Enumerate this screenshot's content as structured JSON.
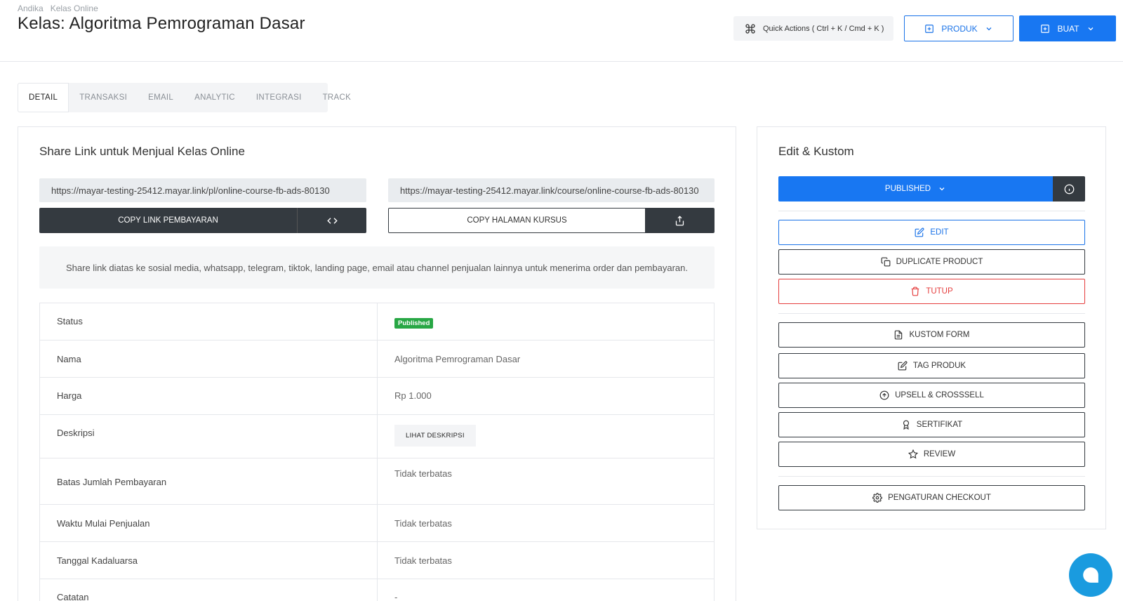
{
  "header": {
    "breadcrumb": [
      "Andika",
      "Kelas Online"
    ],
    "title": "Kelas: Algoritma Pemrograman Dasar",
    "quick_actions_label": "Quick Actions ( Ctrl + K / Cmd + K )",
    "produk_label": "PRODUK",
    "buat_label": "BUAT"
  },
  "tabs": [
    {
      "label": "DETAIL",
      "active": true
    },
    {
      "label": "TRANSAKSI",
      "active": false
    },
    {
      "label": "EMAIL",
      "active": false
    },
    {
      "label": "ANALYTIC",
      "active": false
    },
    {
      "label": "INTEGRASI",
      "active": false
    },
    {
      "label": "TRACK",
      "active": false
    }
  ],
  "share": {
    "title": "Share Link untuk Menjual Kelas Online",
    "payment_url": "https://mayar-testing-25412.mayar.link/pl/online-course-fb-ads-80130",
    "course_url": "https://mayar-testing-25412.mayar.link/course/online-course-fb-ads-80130",
    "copy_payment_label": "COPY LINK PEMBAYARAN",
    "copy_course_label": "COPY HALAMAN KURSUS",
    "note": "Share link diatas ke sosial media, whatsapp, telegram, tiktok, landing page, email atau channel penjualan lainnya untuk menerima order dan pembayaran."
  },
  "details": {
    "status": {
      "label": "Status",
      "value": "Published"
    },
    "nama": {
      "label": "Nama",
      "value": "Algoritma Pemrograman Dasar"
    },
    "harga": {
      "label": "Harga",
      "value": "Rp 1.000"
    },
    "deskripsi": {
      "label": "Deskripsi",
      "button": "LIHAT DESKRIPSI"
    },
    "batas": {
      "label": "Batas Jumlah Pembayaran",
      "value": "Tidak terbatas"
    },
    "waktu": {
      "label": "Waktu Mulai Penjualan",
      "value": "Tidak terbatas"
    },
    "tanggal": {
      "label": "Tanggal Kadaluarsa",
      "value": "Tidak terbatas"
    },
    "catatan": {
      "label": "Catatan",
      "value": "-"
    }
  },
  "edit": {
    "title": "Edit & Kustom",
    "published_label": "PUBLISHED",
    "edit_label": "EDIT",
    "duplicate_label": "DUPLICATE PRODUCT",
    "tutup_label": "TUTUP",
    "kustom_form_label": "KUSTOM FORM",
    "tag_produk_label": "TAG PRODUK",
    "upsell_label": "UPSELL & CROSSSELL",
    "sertifikat_label": "SERTIFIKAT",
    "review_label": "REVIEW",
    "checkout_label": "PENGATURAN CHECKOUT"
  },
  "colors": {
    "primary": "#1877f2",
    "dark": "#343a40",
    "danger": "#e53e3e",
    "success": "#28a745",
    "chat": "#1a9bdf"
  }
}
